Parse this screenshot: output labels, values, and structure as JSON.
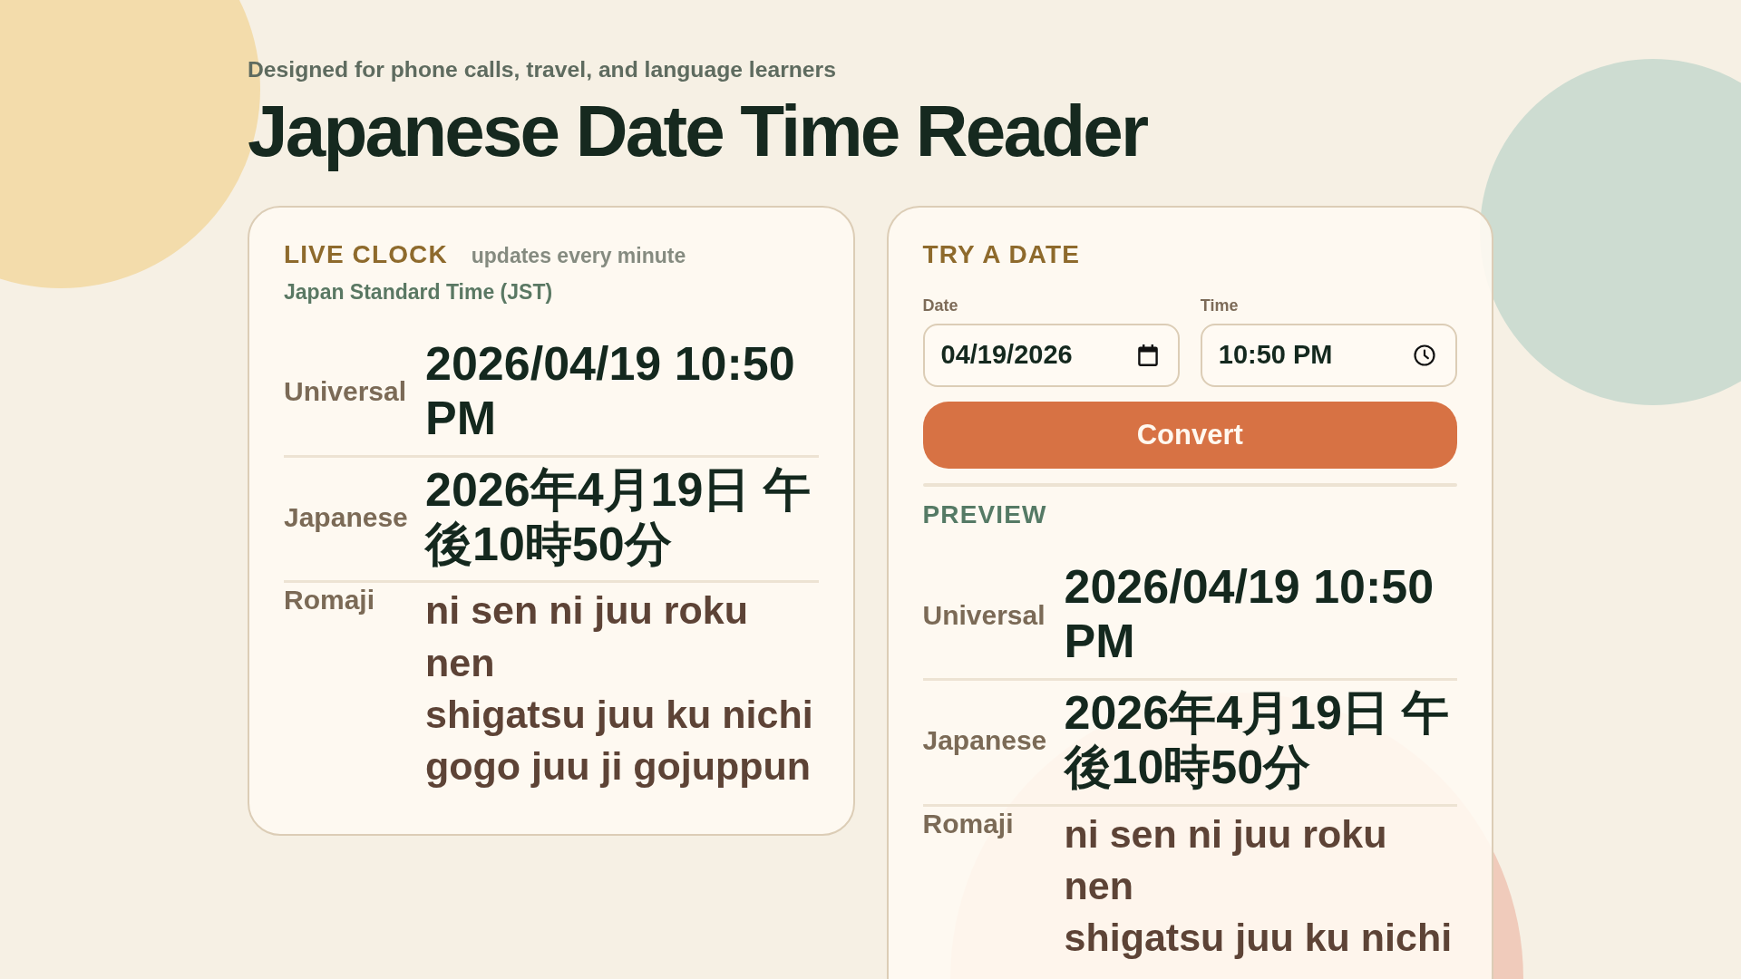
{
  "header": {
    "subtitle": "Designed for phone calls, travel, and language learners",
    "title": "Japanese Date Time Reader"
  },
  "live_clock": {
    "heading": "LIVE CLOCK",
    "note": "updates every minute",
    "timezone": "Japan Standard Time (JST)",
    "rows": [
      {
        "kind": "text",
        "label": "Universal",
        "value": "2026/04/19 10:50 PM"
      },
      {
        "kind": "text",
        "label": "Japanese",
        "value": "2026年4月19日 午後10時50分"
      },
      {
        "kind": "lines",
        "label": "Romaji",
        "lines": [
          "ni sen ni juu roku nen",
          "shigatsu juu ku nichi",
          "gogo juu ji gojuppun"
        ]
      }
    ]
  },
  "try_a_date": {
    "heading": "TRY A DATE",
    "fields": [
      {
        "kind": "date",
        "label": "Date",
        "value": "04/19/2026"
      },
      {
        "kind": "time",
        "label": "Time",
        "value": "10:50 PM"
      }
    ],
    "button": "Convert",
    "preview": {
      "heading": "PREVIEW",
      "rows": [
        {
          "kind": "text",
          "label": "Universal",
          "value": "2026/04/19 10:50 PM"
        },
        {
          "kind": "text",
          "label": "Japanese",
          "value": "2026年4月19日 午後10時50分"
        },
        {
          "kind": "lines",
          "label": "Romaji",
          "lines": [
            "ni sen ni juu roku nen",
            "shigatsu juu ku nichi"
          ]
        }
      ]
    }
  }
}
